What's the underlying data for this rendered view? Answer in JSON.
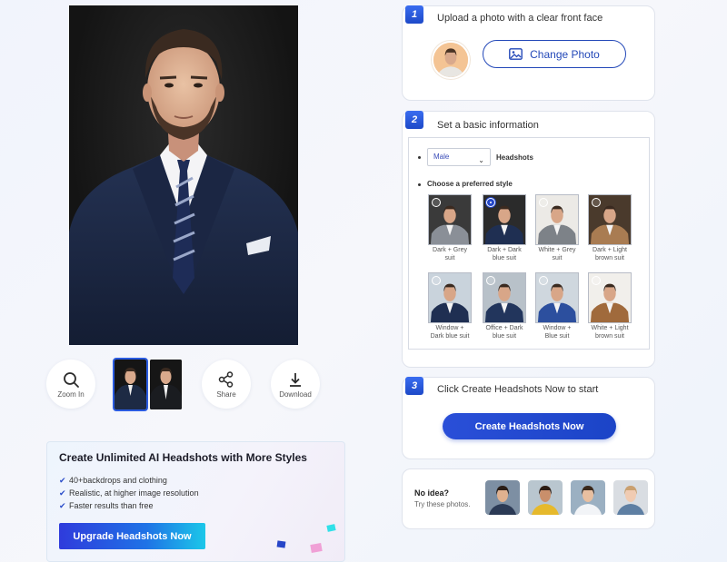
{
  "preview": {
    "thumbnails": [
      {
        "name": "thumb-navy-suit",
        "active": true,
        "suit": "#1d2a44",
        "bg": "#151515"
      },
      {
        "name": "thumb-black-suit",
        "active": false,
        "suit": "#1a1c20",
        "bg": "#161616"
      }
    ],
    "tools": {
      "zoom_label": "Zoom In",
      "share_label": "Share",
      "download_label": "Download"
    }
  },
  "promo": {
    "title": "Create Unlimited AI Headshots with More Styles",
    "features": [
      "40+backdrops and clothing",
      "Realistic, at higher image resolution",
      "Faster results than free"
    ],
    "button_label": "Upgrade Headshots Now"
  },
  "step1": {
    "number": "1",
    "title": "Upload a photo with a clear front face",
    "change_label": "Change Photo"
  },
  "step2": {
    "number": "2",
    "title": "Set a basic information",
    "gender_value": "Male",
    "headshots_label": "Headshots",
    "style_label": "Choose a preferred style",
    "styles": [
      {
        "caption_1": "Dark + Grey",
        "caption_2": "suit",
        "bg": "#3a3a3a",
        "suit": "#8a8f97",
        "selected": false
      },
      {
        "caption_1": "Dark + Dark",
        "caption_2": "blue suit",
        "bg": "#2b2b2b",
        "suit": "#1f2f52",
        "selected": true
      },
      {
        "caption_1": "White + Grey",
        "caption_2": "suit",
        "bg": "#eceae6",
        "suit": "#7d8288",
        "selected": false
      },
      {
        "caption_1": "Dark + Light",
        "caption_2": "brown suit",
        "bg": "#4a3a2c",
        "suit": "#a97c52",
        "selected": false
      },
      {
        "caption_1": "Window +",
        "caption_2": "Dark blue suit",
        "bg": "#c9d3dc",
        "suit": "#1f2f52",
        "selected": false
      },
      {
        "caption_1": "Office + Dark",
        "caption_2": "blue suit",
        "bg": "#b8c1c9",
        "suit": "#22355c",
        "selected": false
      },
      {
        "caption_1": "Window +",
        "caption_2": "Blue suit",
        "bg": "#cfd7de",
        "suit": "#2c4f9e",
        "selected": false
      },
      {
        "caption_1": "White + Light",
        "caption_2": "brown suit",
        "bg": "#f1efeb",
        "suit": "#a06a3c",
        "selected": false
      }
    ]
  },
  "step3": {
    "number": "3",
    "title": "Click Create Headshots Now to start",
    "button_label": "Create Headshots Now"
  },
  "samples": {
    "title": "No idea?",
    "subtitle": "Try these photos.",
    "items": [
      {
        "name": "sample-man-office",
        "bg": "#7d8fa3",
        "cloth": "#2b3a55",
        "skin": "#e0b18f",
        "hair": "#2a1d16"
      },
      {
        "name": "sample-woman-yellow",
        "bg": "#b9c6cf",
        "cloth": "#e6b92c",
        "skin": "#c98f6b",
        "hair": "#2c1b12"
      },
      {
        "name": "sample-man-white-shirt",
        "bg": "#9bb0c2",
        "cloth": "#f2f4f7",
        "skin": "#e8bfa0",
        "hair": "#3a281b"
      },
      {
        "name": "sample-woman-blonde",
        "bg": "#d9dde2",
        "cloth": "#5e7fa3",
        "skin": "#f0cbb2",
        "hair": "#caa070"
      }
    ]
  },
  "colors": {
    "accent": "#2348b8",
    "button_blue": "#1b44c7"
  }
}
